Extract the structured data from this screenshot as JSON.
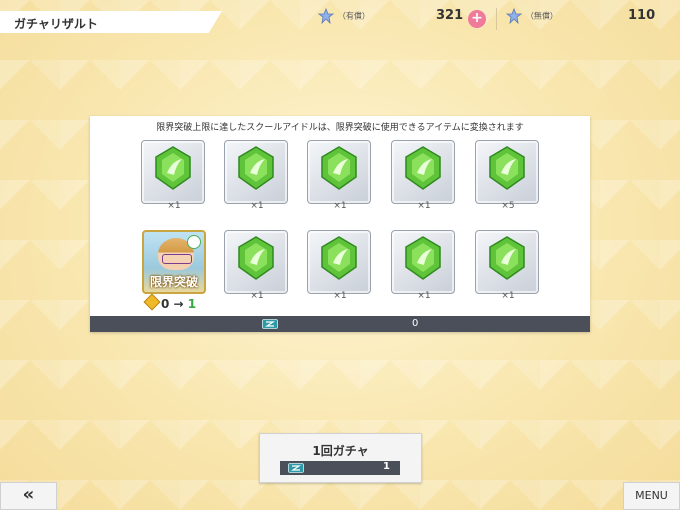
{
  "header": {
    "title": "ガチャリザルト",
    "paid_label": "（有償）",
    "paid_count": "321",
    "free_label": "（無償）",
    "free_count": "110"
  },
  "panel": {
    "notice": "限界突破上限に達したスクールアイドルは、限界突破に使用できるアイテムに変換されます",
    "items_row1": [
      "×1",
      "×1",
      "×1",
      "×1",
      "×5"
    ],
    "items_row2": [
      "×1",
      "×1",
      "×1",
      "×1"
    ],
    "card": {
      "limit_label": "限界突破",
      "from": "0",
      "arrow": "→",
      "to": "1"
    },
    "currency_value": "0"
  },
  "gacha_button": {
    "label": "1回ガチャ",
    "cost": "1"
  },
  "back_button": {
    "label": "«"
  },
  "menu_button": {
    "label": "MENU"
  },
  "colors": {
    "gem_green": "#5fc43a",
    "plus_pink": "#f07a9a",
    "bar_dark": "#4a4f5a"
  }
}
